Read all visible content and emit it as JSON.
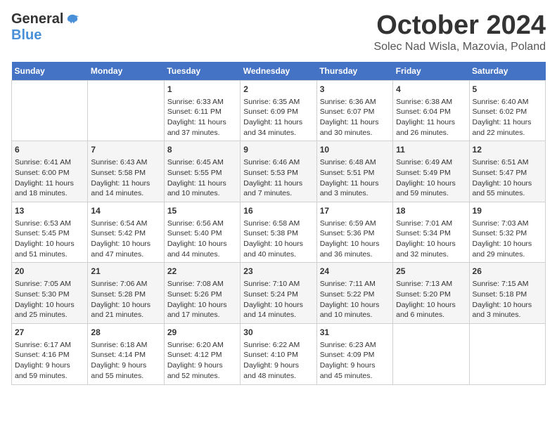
{
  "logo": {
    "general": "General",
    "blue": "Blue"
  },
  "title": "October 2024",
  "location": "Solec Nad Wisla, Mazovia, Poland",
  "days_header": [
    "Sunday",
    "Monday",
    "Tuesday",
    "Wednesday",
    "Thursday",
    "Friday",
    "Saturday"
  ],
  "weeks": [
    [
      {
        "day": "",
        "content": ""
      },
      {
        "day": "",
        "content": ""
      },
      {
        "day": "1",
        "content": "Sunrise: 6:33 AM\nSunset: 6:11 PM\nDaylight: 11 hours\nand 37 minutes."
      },
      {
        "day": "2",
        "content": "Sunrise: 6:35 AM\nSunset: 6:09 PM\nDaylight: 11 hours\nand 34 minutes."
      },
      {
        "day": "3",
        "content": "Sunrise: 6:36 AM\nSunset: 6:07 PM\nDaylight: 11 hours\nand 30 minutes."
      },
      {
        "day": "4",
        "content": "Sunrise: 6:38 AM\nSunset: 6:04 PM\nDaylight: 11 hours\nand 26 minutes."
      },
      {
        "day": "5",
        "content": "Sunrise: 6:40 AM\nSunset: 6:02 PM\nDaylight: 11 hours\nand 22 minutes."
      }
    ],
    [
      {
        "day": "6",
        "content": "Sunrise: 6:41 AM\nSunset: 6:00 PM\nDaylight: 11 hours\nand 18 minutes."
      },
      {
        "day": "7",
        "content": "Sunrise: 6:43 AM\nSunset: 5:58 PM\nDaylight: 11 hours\nand 14 minutes."
      },
      {
        "day": "8",
        "content": "Sunrise: 6:45 AM\nSunset: 5:55 PM\nDaylight: 11 hours\nand 10 minutes."
      },
      {
        "day": "9",
        "content": "Sunrise: 6:46 AM\nSunset: 5:53 PM\nDaylight: 11 hours\nand 7 minutes."
      },
      {
        "day": "10",
        "content": "Sunrise: 6:48 AM\nSunset: 5:51 PM\nDaylight: 11 hours\nand 3 minutes."
      },
      {
        "day": "11",
        "content": "Sunrise: 6:49 AM\nSunset: 5:49 PM\nDaylight: 10 hours\nand 59 minutes."
      },
      {
        "day": "12",
        "content": "Sunrise: 6:51 AM\nSunset: 5:47 PM\nDaylight: 10 hours\nand 55 minutes."
      }
    ],
    [
      {
        "day": "13",
        "content": "Sunrise: 6:53 AM\nSunset: 5:45 PM\nDaylight: 10 hours\nand 51 minutes."
      },
      {
        "day": "14",
        "content": "Sunrise: 6:54 AM\nSunset: 5:42 PM\nDaylight: 10 hours\nand 47 minutes."
      },
      {
        "day": "15",
        "content": "Sunrise: 6:56 AM\nSunset: 5:40 PM\nDaylight: 10 hours\nand 44 minutes."
      },
      {
        "day": "16",
        "content": "Sunrise: 6:58 AM\nSunset: 5:38 PM\nDaylight: 10 hours\nand 40 minutes."
      },
      {
        "day": "17",
        "content": "Sunrise: 6:59 AM\nSunset: 5:36 PM\nDaylight: 10 hours\nand 36 minutes."
      },
      {
        "day": "18",
        "content": "Sunrise: 7:01 AM\nSunset: 5:34 PM\nDaylight: 10 hours\nand 32 minutes."
      },
      {
        "day": "19",
        "content": "Sunrise: 7:03 AM\nSunset: 5:32 PM\nDaylight: 10 hours\nand 29 minutes."
      }
    ],
    [
      {
        "day": "20",
        "content": "Sunrise: 7:05 AM\nSunset: 5:30 PM\nDaylight: 10 hours\nand 25 minutes."
      },
      {
        "day": "21",
        "content": "Sunrise: 7:06 AM\nSunset: 5:28 PM\nDaylight: 10 hours\nand 21 minutes."
      },
      {
        "day": "22",
        "content": "Sunrise: 7:08 AM\nSunset: 5:26 PM\nDaylight: 10 hours\nand 17 minutes."
      },
      {
        "day": "23",
        "content": "Sunrise: 7:10 AM\nSunset: 5:24 PM\nDaylight: 10 hours\nand 14 minutes."
      },
      {
        "day": "24",
        "content": "Sunrise: 7:11 AM\nSunset: 5:22 PM\nDaylight: 10 hours\nand 10 minutes."
      },
      {
        "day": "25",
        "content": "Sunrise: 7:13 AM\nSunset: 5:20 PM\nDaylight: 10 hours\nand 6 minutes."
      },
      {
        "day": "26",
        "content": "Sunrise: 7:15 AM\nSunset: 5:18 PM\nDaylight: 10 hours\nand 3 minutes."
      }
    ],
    [
      {
        "day": "27",
        "content": "Sunrise: 6:17 AM\nSunset: 4:16 PM\nDaylight: 9 hours\nand 59 minutes."
      },
      {
        "day": "28",
        "content": "Sunrise: 6:18 AM\nSunset: 4:14 PM\nDaylight: 9 hours\nand 55 minutes."
      },
      {
        "day": "29",
        "content": "Sunrise: 6:20 AM\nSunset: 4:12 PM\nDaylight: 9 hours\nand 52 minutes."
      },
      {
        "day": "30",
        "content": "Sunrise: 6:22 AM\nSunset: 4:10 PM\nDaylight: 9 hours\nand 48 minutes."
      },
      {
        "day": "31",
        "content": "Sunrise: 6:23 AM\nSunset: 4:09 PM\nDaylight: 9 hours\nand 45 minutes."
      },
      {
        "day": "",
        "content": ""
      },
      {
        "day": "",
        "content": ""
      }
    ]
  ]
}
